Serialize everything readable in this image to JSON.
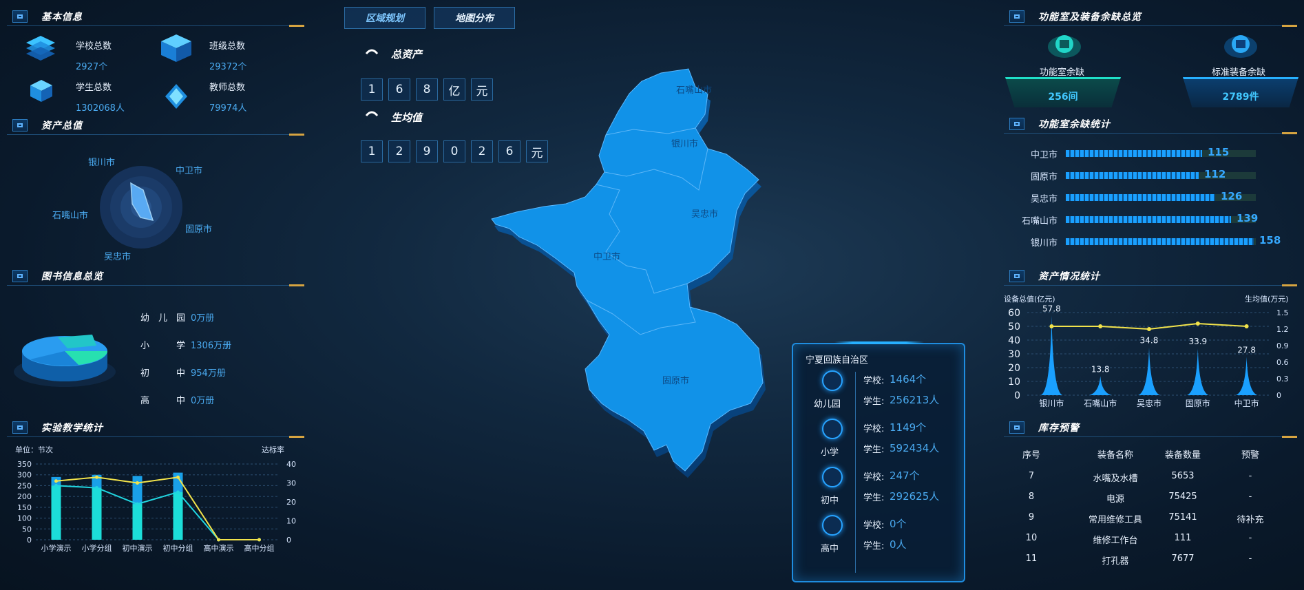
{
  "tabs": [
    {
      "label": "区域规划"
    },
    {
      "label": "地图分布"
    }
  ],
  "basic_info": {
    "title": "基本信息",
    "items": [
      {
        "label": "学校总数",
        "value": "2927个",
        "icon": "stack-icon"
      },
      {
        "label": "班级总数",
        "value": "29372个",
        "icon": "cube-icon"
      },
      {
        "label": "学生总数",
        "value": "1302068人",
        "icon": "cube-small-icon"
      },
      {
        "label": "教师总数",
        "value": "79974人",
        "icon": "diamond-icon"
      }
    ]
  },
  "asset_overview": {
    "title": "资产总值",
    "radar_labels": [
      "银川市",
      "中卫市",
      "固原市",
      "吴忠市",
      "石嘴山市"
    ]
  },
  "books": {
    "title": "图书信息总览",
    "rows": [
      {
        "label": "幼　儿　园",
        "value": "0万册"
      },
      {
        "label": "小　　　学",
        "value": "1306万册"
      },
      {
        "label": "初　　　中",
        "value": "954万册"
      },
      {
        "label": "高　　　中",
        "value": "0万册"
      }
    ]
  },
  "experiment": {
    "title": "实验教学统计",
    "unit": "单位：节次",
    "right_label": "达标率",
    "y_ticks": [
      "350",
      "300",
      "250",
      "200",
      "150",
      "100",
      "50",
      "0"
    ],
    "y2_ticks": [
      "40",
      "30",
      "20",
      "10",
      "0"
    ],
    "chart_data": {
      "type": "bar",
      "categories": [
        "小学演示",
        "小学分组",
        "初中演示",
        "初中分组",
        "高中演示",
        "高中分组"
      ],
      "series": [
        {
          "values": [
            290,
            300,
            295,
            310,
            0,
            0
          ]
        },
        {
          "values": [
            250,
            240,
            165,
            220,
            0,
            0
          ]
        },
        {
          "values": [
            31,
            33,
            30,
            33,
            0,
            0
          ]
        }
      ],
      "ylim": [
        0,
        350
      ],
      "y2lim": [
        0,
        40
      ]
    }
  },
  "total_assets": {
    "title": "总资产",
    "digits": [
      "1",
      "6",
      "8",
      "亿",
      "元"
    ]
  },
  "per_student": {
    "title": "生均值",
    "digits": [
      "1",
      "2",
      "9",
      "0",
      "2",
      "6",
      "元"
    ]
  },
  "map": {
    "regions": [
      "石嘴山市",
      "银川市",
      "吴忠市",
      "中卫市",
      "固原市"
    ]
  },
  "region_info": {
    "title": "宁夏回族自治区",
    "groups": [
      {
        "name": "幼儿园",
        "schools_label": "学校:",
        "schools": "1464个",
        "students_label": "学生:",
        "students": "256213人"
      },
      {
        "name": "小学",
        "schools_label": "学校:",
        "schools": "1149个",
        "students_label": "学生:",
        "students": "592434人"
      },
      {
        "name": "初中",
        "schools_label": "学校:",
        "schools": "247个",
        "students_label": "学生:",
        "students": "292625人"
      },
      {
        "name": "高中",
        "schools_label": "学校:",
        "schools": "0个",
        "students_label": "学生:",
        "students": "0人"
      }
    ]
  },
  "function_room": {
    "title": "功能室及装备余缺总览",
    "room_label": "功能室余缺",
    "room_value": "256间",
    "equip_label": "标准装备余缺",
    "equip_value": "2789件"
  },
  "room_stats": {
    "title": "功能室余缺统计",
    "chart_data": {
      "type": "bar",
      "categories": [
        "中卫市",
        "固原市",
        "吴忠市",
        "石嘴山市",
        "银川市"
      ],
      "values": [
        115,
        112,
        126,
        139,
        158
      ]
    }
  },
  "asset_stats": {
    "title": "资产情况统计",
    "left_axis_label": "设备总值(亿元)",
    "right_axis_label": "生均值(万元)",
    "y_ticks": [
      "60",
      "50",
      "40",
      "30",
      "20",
      "10",
      "0"
    ],
    "y2_ticks": [
      "1.5",
      "1.2",
      "0.9",
      "0.6",
      "0.3",
      "0"
    ],
    "chart_data": {
      "type": "area",
      "categories": [
        "银川市",
        "石嘴山市",
        "吴忠市",
        "固原市",
        "中卫市"
      ],
      "series": [
        {
          "values": [
            57.8,
            13.8,
            34.8,
            33.9,
            27.8
          ]
        },
        {
          "values": [
            1.25,
            1.25,
            1.2,
            1.3,
            1.25
          ]
        }
      ],
      "ylim": [
        0,
        60
      ],
      "y2lim": [
        0,
        1.5
      ]
    }
  },
  "stock": {
    "title": "库存预警",
    "headers": [
      "序号",
      "装备名称",
      "装备数量",
      "预警"
    ],
    "rows": [
      [
        "7",
        "水嘴及水槽",
        "5653",
        "-"
      ],
      [
        "8",
        "电源",
        "75425",
        "-"
      ],
      [
        "9",
        "常用维修工具",
        "75141",
        "待补充"
      ],
      [
        "10",
        "维修工作台",
        "111",
        "-"
      ],
      [
        "11",
        "打孔器",
        "7677",
        "-"
      ]
    ]
  },
  "colors": {
    "accent": "#1aa0ff",
    "map_fill": "#1192e8",
    "gold": "#d6a441",
    "cyan": "#21f0e6",
    "yellow": "#f2e34b"
  }
}
